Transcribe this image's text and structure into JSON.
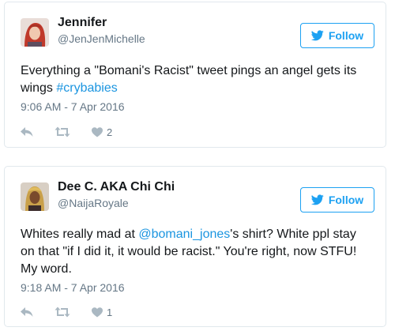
{
  "colors": {
    "accent": "#1da1f2",
    "link": "#1b95e0",
    "muted": "#657786",
    "action_icon": "#aab8c2",
    "border": "#e1e8ed"
  },
  "tweets": [
    {
      "display_name": "Jennifer",
      "handle": "@JenJenMichelle",
      "follow_label": "Follow",
      "text_before": "Everything a \"Bomani's Racist\" tweet pings an angel gets its wings ",
      "link": "#crybabies",
      "text_after": "",
      "timestamp": "9:06 AM - 7 Apr 2016",
      "like_count": "2",
      "icons": [
        "reply-icon",
        "retweet-icon",
        "like-icon"
      ]
    },
    {
      "display_name": "Dee C. AKA Chi Chi",
      "handle": "@NaijaRoyale",
      "follow_label": "Follow",
      "text_before": "Whites really mad at ",
      "link": "@bomani_jones",
      "text_after": "'s shirt? White ppl stay on that \"if I did it, it would be racist.\" You're right, now STFU! My word.",
      "timestamp": "9:18 AM - 7 Apr 2016",
      "like_count": "1",
      "icons": [
        "reply-icon",
        "retweet-icon",
        "like-icon"
      ]
    }
  ]
}
